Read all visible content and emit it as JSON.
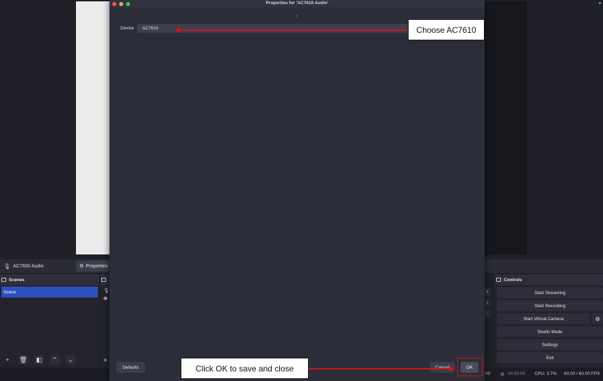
{
  "dialog": {
    "title": "Properties for 'AC7610 Audio'",
    "device_label": "Device",
    "device_value": "AC7610",
    "defaults_label": "Defaults",
    "cancel_label": "Cancel",
    "ok_label": "OK"
  },
  "source_bar": {
    "source_name": "AC7600 Audio",
    "properties_label": "Properties"
  },
  "scenes": {
    "header": "Scenes",
    "items": [
      "Scène"
    ]
  },
  "controls": {
    "header": "Controls",
    "start_streaming": "Start Streaming",
    "start_recording": "Start Recording",
    "start_virtual_camera": "Start Virtual Camera",
    "studio_mode": "Studio Mode",
    "settings": "Settings",
    "exit": "Exit"
  },
  "status": {
    "time_partial": "00",
    "rec_time": "00:00:00",
    "cpu": "CPU: 3.7%",
    "fps": "60.00 / 60.00 FPS"
  },
  "annotations": {
    "device_callout": "Choose AC7610",
    "ok_callout": "Click OK to save and close"
  },
  "colors": {
    "accent": "#2e4fc0",
    "annotation_red": "#d4141a"
  }
}
